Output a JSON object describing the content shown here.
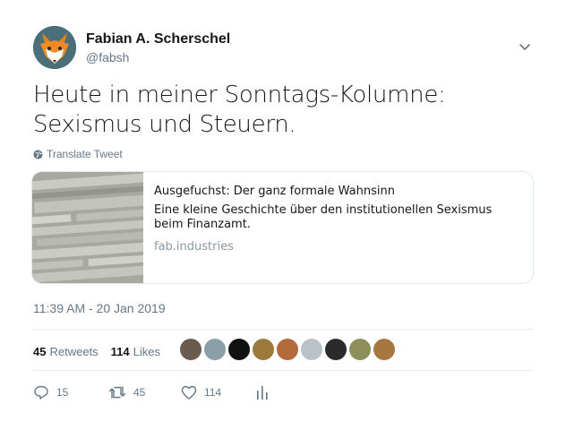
{
  "author": {
    "name": "Fabian A. Scherschel",
    "handle": "@fabsh",
    "avatar_icon": "fox-avatar-icon"
  },
  "tweet": {
    "text": "Heute in meiner Sonntags-Kolumne: Sexismus und Steuern.",
    "translate_label": "Translate Tweet",
    "timestamp": "11:39 AM - 20 Jan 2019"
  },
  "card": {
    "title": "Ausgefuchst: Der ganz formale Wahnsinn",
    "description": "Eine kleine Geschichte über den institutionellen Sexismus beim Finanzamt.",
    "domain": "fab.industries"
  },
  "stats": {
    "retweets_count": "45",
    "retweets_label": "Retweets",
    "likes_count": "114",
    "likes_label": "Likes",
    "likers": [
      "#6b5a4e",
      "#8aa0a8",
      "#111111",
      "#9b7a3c",
      "#b26a3a",
      "#b9c2c7",
      "#2b2b2b",
      "#8c8f5a",
      "#a8773f"
    ]
  },
  "actions": {
    "reply_count": "15",
    "retweet_count": "45",
    "like_count": "114"
  },
  "colors": {
    "text_primary": "#14171a",
    "text_secondary": "#657786",
    "border": "#e1e8ed",
    "avatar_bg": "#4a6f79",
    "fox_orange": "#e8821e"
  }
}
